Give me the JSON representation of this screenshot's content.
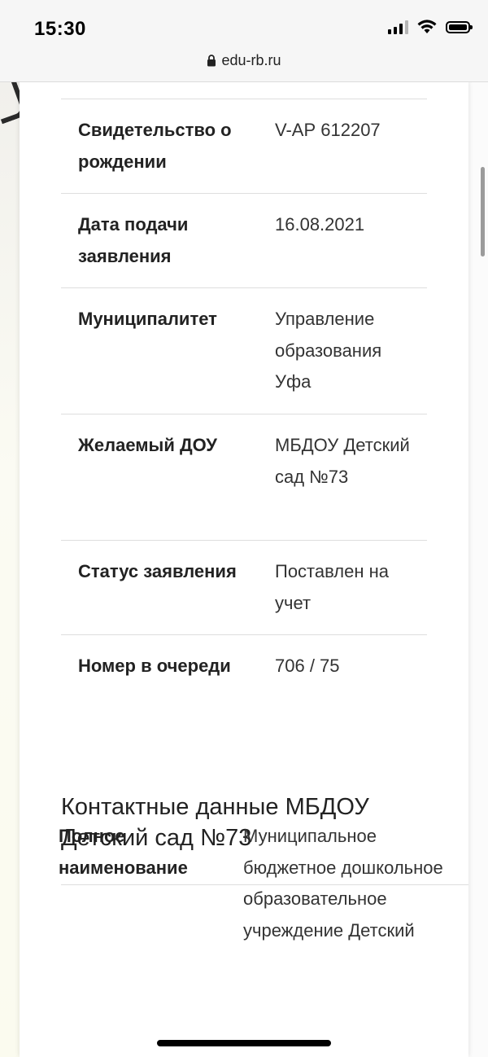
{
  "status_bar": {
    "time": "15:30"
  },
  "address_bar": {
    "url": "edu-rb.ru"
  },
  "application_info": {
    "rows": [
      {
        "label": "Свидетельство о рождении",
        "value": "V-АР 612207"
      },
      {
        "label": "Дата подачи заявления",
        "value": "16.08.2021"
      },
      {
        "label": "Муниципалитет",
        "value": "Управление образования Уфа"
      },
      {
        "label": "Желаемый ДОУ",
        "value": "МБДОУ Детский сад №73"
      },
      {
        "label": "Статус заявления",
        "value": "Поставлен на учет"
      },
      {
        "label": "Номер в очереди",
        "value": "706 / 75"
      }
    ]
  },
  "contacts": {
    "title": "Контактные данные МБДОУ Детский сад №73",
    "rows": [
      {
        "label": "Полное наименование",
        "value": "Муниципальное бюджетное дошкольное образовательное учреждение Детский"
      }
    ]
  }
}
